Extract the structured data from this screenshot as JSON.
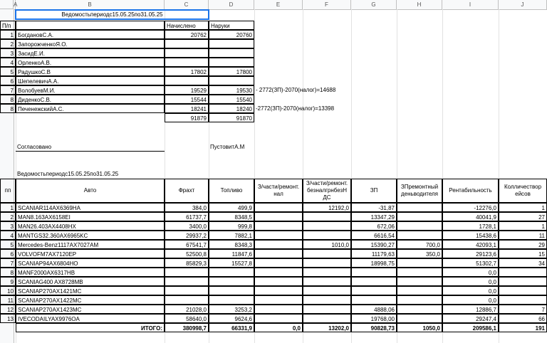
{
  "columns": [
    "A",
    "B",
    "C",
    "D",
    "E",
    "F",
    "G",
    "H",
    "I",
    "J"
  ],
  "top": {
    "title": "Ведомостьпериодс15.05.25по31.05.25",
    "hdr_pn": "П/п",
    "hdr_accrued": "Начислено",
    "hdr_cash": "Наруки",
    "rows": [
      {
        "n": "1",
        "name": "БогдановС.А.",
        "acc": "20762",
        "cash": "20760",
        "note": ""
      },
      {
        "n": "2",
        "name": "ЗапорожченкоЯ.О.",
        "acc": "",
        "cash": "",
        "note": ""
      },
      {
        "n": "3",
        "name": "ЗасидЕ.И.",
        "acc": "",
        "cash": "",
        "note": ""
      },
      {
        "n": "4",
        "name": "ОрленкоА.В.",
        "acc": "",
        "cash": "",
        "note": ""
      },
      {
        "n": "5",
        "name": "РадушкоС.В",
        "acc": "17802",
        "cash": "17800",
        "note": ""
      },
      {
        "n": "6",
        "name": "ШепелевичА.А.",
        "acc": "",
        "cash": "",
        "note": ""
      },
      {
        "n": "7",
        "name": "ВолобуевМ.И.",
        "acc": "19529",
        "cash": "19530",
        "note": "- 2772(ЗП)-2070(налог)=14688"
      },
      {
        "n": "8",
        "name": "ДиденкоС.В.",
        "acc": "15544",
        "cash": "15540",
        "note": ""
      },
      {
        "n": "8",
        "name": "ПеченежскийА.С.",
        "acc": "18241",
        "cash": "18240",
        "note": "-2772(ЗП)-2070(налог)=13398"
      }
    ],
    "total_acc": "91879",
    "total_cash": "91870"
  },
  "agreed": "Согласовано",
  "signer": "ПустовитА.М",
  "bottom": {
    "title": "Ведомостьпериодс15.05.25по31.05.25",
    "headers": {
      "pp": "пп",
      "auto": "Авто",
      "freight": "Фрахт",
      "fuel": "Топливо",
      "parts_cash": "З/части/ремонт. нал",
      "parts_noncash": "З/части/ремонт. безналгрнбезН ДС",
      "salary": "ЗП",
      "driver_repair": "ЗПремонтный деньводителя",
      "profit": "Рентабильность",
      "trips": "Колличествор ейсов"
    },
    "rows": [
      {
        "n": "1",
        "auto": "SCANIAR114AX6369HA",
        "freight": "384,0",
        "fuel": "499,9",
        "pc": "",
        "pn": "12192,0",
        "sal": "-31,87",
        "dr": "",
        "profit": "-12276,0",
        "trips": "1"
      },
      {
        "n": "2",
        "auto": "MAN8.163AX6158EI",
        "freight": "61737,7",
        "fuel": "8348,5",
        "pc": "",
        "pn": "",
        "sal": "13347,29",
        "dr": "",
        "profit": "40041,9",
        "trips": "27"
      },
      {
        "n": "3",
        "auto": "MAN26.403AX4408HX",
        "freight": "3400,0",
        "fuel": "999,8",
        "pc": "",
        "pn": "",
        "sal": "672,06",
        "dr": "",
        "profit": "1728,1",
        "trips": "1"
      },
      {
        "n": "4",
        "auto": "MANTGS32.360AX6965KC",
        "freight": "29937,2",
        "fuel": "7882,1",
        "pc": "",
        "pn": "",
        "sal": "6616,54",
        "dr": "",
        "profit": "15438,6",
        "trips": "11"
      },
      {
        "n": "5",
        "auto": "Mercedes-Benz1117AX7027AM",
        "freight": "67541,7",
        "fuel": "8348,3",
        "pc": "",
        "pn": "1010,0",
        "sal": "15390,27",
        "dr": "700,0",
        "profit": "42093,1",
        "trips": "29"
      },
      {
        "n": "6",
        "auto": "VOLVOFM7AX7120EP",
        "freight": "52500,8",
        "fuel": "11847,6",
        "pc": "",
        "pn": "",
        "sal": "11179,63",
        "dr": "350,0",
        "profit": "29123,6",
        "trips": "15"
      },
      {
        "n": "7",
        "auto": "SCANIAP94AX6804HO",
        "freight": "85829,3",
        "fuel": "15527,8",
        "pc": "",
        "pn": "",
        "sal": "18998,75",
        "dr": "",
        "profit": "51302,7",
        "trips": "34"
      },
      {
        "n": "8",
        "auto": "MANF2000AX6317HB",
        "freight": "",
        "fuel": "",
        "pc": "",
        "pn": "",
        "sal": "",
        "dr": "",
        "profit": "0,0",
        "trips": ""
      },
      {
        "n": "9",
        "auto": "SCANIAG400 AX8728MB",
        "freight": "",
        "fuel": "",
        "pc": "",
        "pn": "",
        "sal": "",
        "dr": "",
        "profit": "0,0",
        "trips": ""
      },
      {
        "n": "10",
        "auto": "SCANIAP270AX1421MC",
        "freight": "",
        "fuel": "",
        "pc": "",
        "pn": "",
        "sal": "",
        "dr": "",
        "profit": "0,0",
        "trips": ""
      },
      {
        "n": "11",
        "auto": "SCANIAP270AX1422MC",
        "freight": "",
        "fuel": "",
        "pc": "",
        "pn": "",
        "sal": "",
        "dr": "",
        "profit": "0,0",
        "trips": ""
      },
      {
        "n": "12",
        "auto": "SCANIAP270AX1423MC",
        "freight": "21028,0",
        "fuel": "3253,2",
        "pc": "",
        "pn": "",
        "sal": "4888,06",
        "dr": "",
        "profit": "12886,7",
        "trips": "7"
      },
      {
        "n": "13",
        "auto": "IVECODAILYAX9976OA",
        "freight": "58640,0",
        "fuel": "9624,6",
        "pc": "",
        "pn": "",
        "sal": "19768,00",
        "dr": "",
        "profit": "29247,4",
        "trips": "66"
      }
    ],
    "total": {
      "label": "ИТОГО:",
      "freight": "380998,7",
      "fuel": "66331,9",
      "pc": "0,0",
      "pn": "13202,0",
      "sal": "90828,73",
      "dr": "1050,0",
      "profit": "209586,1",
      "trips": "191"
    }
  }
}
